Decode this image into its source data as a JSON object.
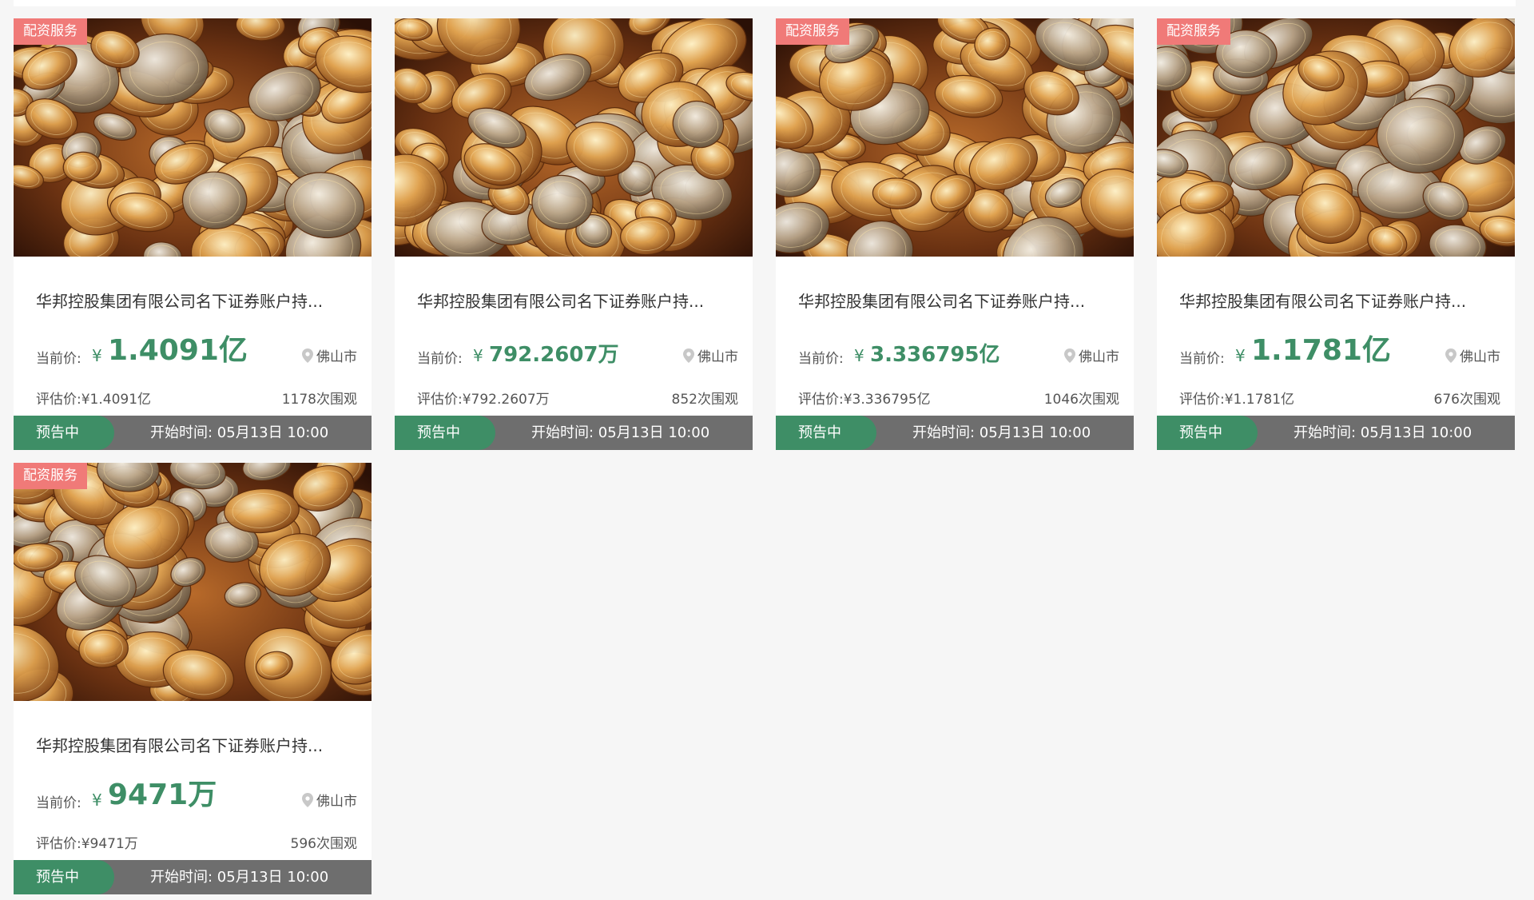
{
  "cards": [
    {
      "badge": "配资服务",
      "title": "华邦控股集团有限公司名下证券账户持...",
      "price_label": "当前价:",
      "currency": "¥",
      "price": "1.4091亿",
      "price_size": "big",
      "location": "佛山市",
      "estimate": "评估价:¥1.4091亿",
      "views": "1178次围观",
      "status": "预告中",
      "start_time": "开始时间: 05月13日 10:00"
    },
    {
      "badge": "",
      "title": "华邦控股集团有限公司名下证券账户持...",
      "price_label": "当前价:",
      "currency": "¥",
      "price": "792.2607万",
      "price_size": "mid",
      "location": "佛山市",
      "estimate": "评估价:¥792.2607万",
      "views": "852次围观",
      "status": "预告中",
      "start_time": "开始时间: 05月13日 10:00"
    },
    {
      "badge": "配资服务",
      "title": "华邦控股集团有限公司名下证券账户持...",
      "price_label": "当前价:",
      "currency": "¥",
      "price": "3.336795亿",
      "price_size": "mid",
      "location": "佛山市",
      "estimate": "评估价:¥3.336795亿",
      "views": "1046次围观",
      "status": "预告中",
      "start_time": "开始时间: 05月13日 10:00"
    },
    {
      "badge": "配资服务",
      "title": "华邦控股集团有限公司名下证券账户持...",
      "price_label": "当前价:",
      "currency": "¥",
      "price": "1.1781亿",
      "price_size": "big",
      "location": "佛山市",
      "estimate": "评估价:¥1.1781亿",
      "views": "676次围观",
      "status": "预告中",
      "start_time": "开始时间: 05月13日 10:00"
    },
    {
      "badge": "配资服务",
      "title": "华邦控股集团有限公司名下证券账户持...",
      "price_label": "当前价:",
      "currency": "¥",
      "price": "9471万",
      "price_size": "big",
      "location": "佛山市",
      "estimate": "评估价:¥9471万",
      "views": "596次围观",
      "status": "预告中",
      "start_time": "开始时间: 05月13日 10:00"
    }
  ],
  "colors": {
    "accent_green": "#3e8e66",
    "badge_red": "#f07a78",
    "footer_gray": "#6e6e6e",
    "page_bg": "#f6f6f6"
  },
  "icons": {
    "thumbnail": "coins-image",
    "location": "map-pin-icon"
  }
}
